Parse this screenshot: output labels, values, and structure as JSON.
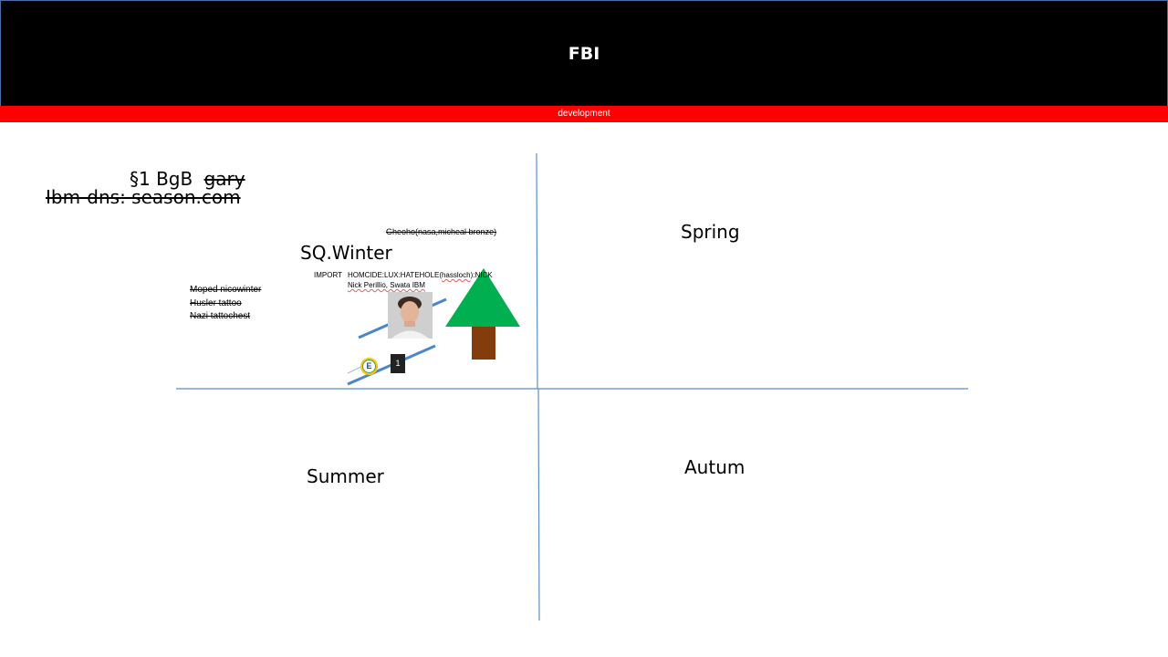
{
  "header": {
    "title": "FBI"
  },
  "banner": {
    "label": "development"
  },
  "notes": {
    "section_law": "§1 BgB",
    "struck_name": "gary",
    "dns": "Ibm-dns: season.com",
    "gheoho": "Gheoho(nasa,micheal bronze)",
    "winter_title": "SQ.Winter",
    "import_label": "IMPORT",
    "homicide_prefix": "HOMCIDE:LUX:HATEHOLE(",
    "homicide_hass": "hassloch",
    "homicide_suffix": "):NICK",
    "perillio": "Nick Perillio, Swata IBM",
    "moped_list": [
      "Moped nicowinter",
      "Husler tattoo",
      "Nazi tattochest"
    ]
  },
  "seasons": {
    "spring": "Spring",
    "summer": "Summer",
    "autum": "Autum"
  },
  "icons": {
    "badge_e": "E",
    "badge_dark": "1"
  },
  "colors": {
    "header_bg": "#000000",
    "banner_bg": "#ff0000",
    "quadrant_lines": "#5b8fc7",
    "tree_crown": "#00b050",
    "tree_trunk": "#843c0c",
    "strike_lines": "#4a86c8"
  }
}
